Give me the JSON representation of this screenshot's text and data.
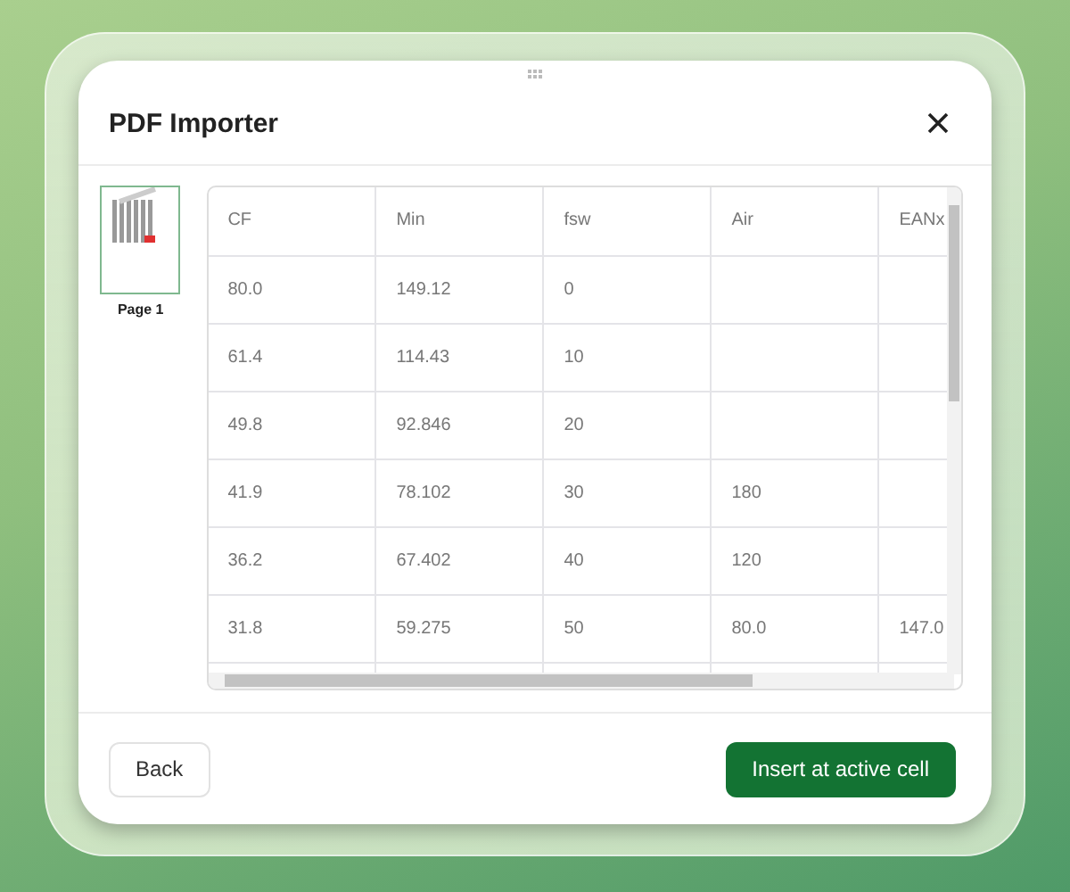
{
  "dialog": {
    "title": "PDF Importer"
  },
  "pages": [
    {
      "label": "Page 1",
      "selected": true
    }
  ],
  "table": {
    "columns": [
      "CF",
      "Min",
      "fsw",
      "Air",
      "EANx"
    ],
    "rows": [
      [
        "80.0",
        "149.12",
        "0",
        null,
        null
      ],
      [
        "61.4",
        "114.43",
        "10",
        null,
        null
      ],
      [
        "49.8",
        "92.846",
        "20",
        null,
        null
      ],
      [
        "41.9",
        "78.102",
        "30",
        "180",
        null
      ],
      [
        "36.2",
        "67.402",
        "40",
        "120",
        null
      ],
      [
        "31.8",
        "59.275",
        "50",
        "80.0",
        "147.0"
      ]
    ]
  },
  "buttons": {
    "back": "Back",
    "insert": "Insert at active cell"
  }
}
